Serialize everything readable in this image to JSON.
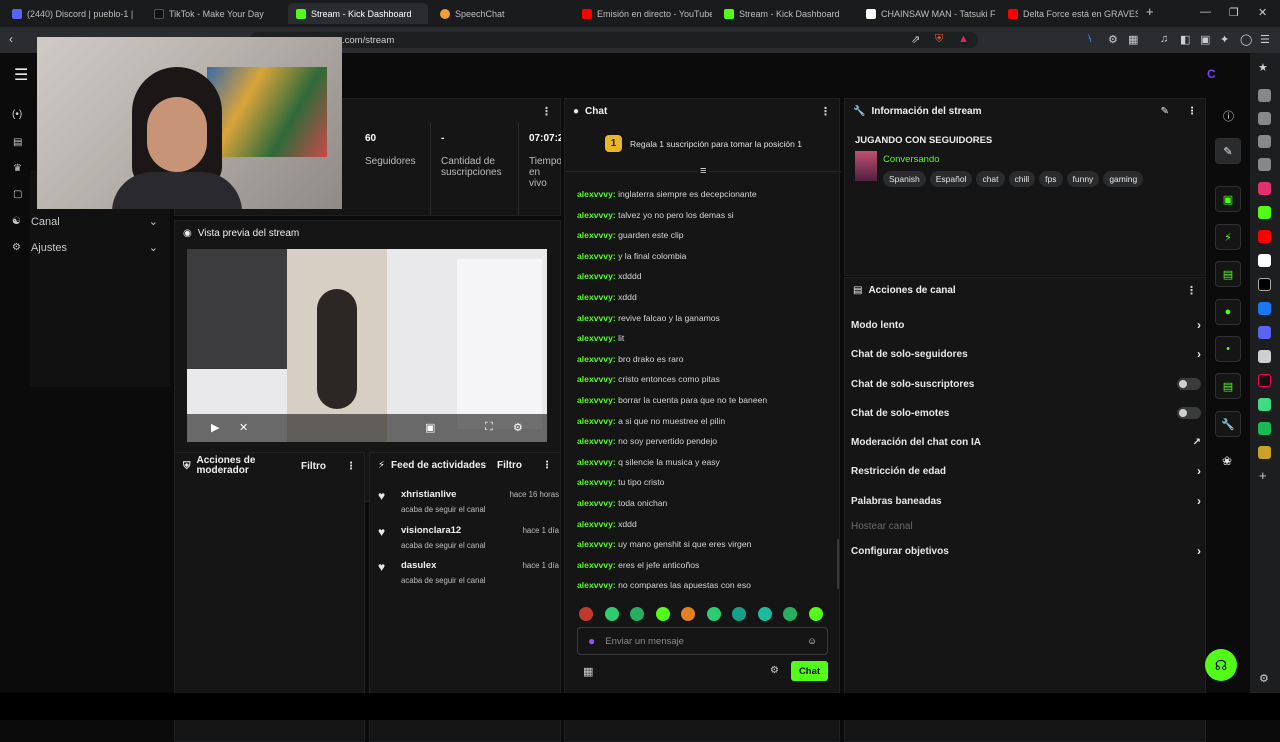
{
  "browser": {
    "tabs": [
      {
        "title": "(2440) Discord | pueblo-1 |",
        "color": "#5865f2"
      },
      {
        "title": "TikTok - Make Your Day",
        "color": "#111111"
      },
      {
        "title": "Stream - Kick Dashboard",
        "color": "#53fc18"
      },
      {
        "title": "SpeechChat",
        "color": "#f0a030"
      },
      {
        "title": "Emisión en directo - YouTube S",
        "color": "#ff0000"
      },
      {
        "title": "Stream - Kick Dashboard",
        "color": "#53fc18"
      },
      {
        "title": "CHAINSAW MAN - Tatsuki Fuj",
        "color": "#ffffff"
      },
      {
        "title": "Delta Force está en GRAVES PR",
        "color": "#ff0000"
      }
    ],
    "new_tab": "+",
    "url": ".com/stream"
  },
  "dashboard": {
    "stats": [
      {
        "value": "60",
        "label": "Seguidores"
      },
      {
        "value": "-",
        "label": "Cantidad de suscripciones"
      },
      {
        "value": "07:07:2",
        "label": "Tiempo en vivo"
      }
    ],
    "sidebar": [
      {
        "label": "Canal",
        "icon": "people-icon"
      },
      {
        "label": "Ajustes",
        "icon": "gear-icon"
      }
    ],
    "preview_title": "Vista previa del stream"
  },
  "mod_actions": {
    "title": "Acciones de moderador",
    "filter": "Filtro"
  },
  "activity": {
    "title": "Feed de actividades",
    "filter": "Filtro",
    "items": [
      {
        "name": "xhristianlive",
        "sub": "acaba de seguir el canal",
        "time": "hace 16 horas"
      },
      {
        "name": "visionclara12",
        "sub": "acaba de seguir el canal",
        "time": "hace 1 día"
      },
      {
        "name": "dasulex",
        "sub": "acaba de seguir el canal",
        "time": "hace 1 día"
      }
    ]
  },
  "chat": {
    "title": "Chat",
    "gift_banner": "Regala 1 suscripción para tomar la posición 1",
    "gift_rank": "1",
    "messages": [
      {
        "user": "alexvvvy:",
        "text": "inglaterra siempre es decepcionante"
      },
      {
        "user": "alexvvvy:",
        "text": "talvez yo no pero los demas si"
      },
      {
        "user": "alexvvvy:",
        "text": "guarden este clip"
      },
      {
        "user": "alexvvvy:",
        "text": "y la final colombia"
      },
      {
        "user": "alexvvvy:",
        "text": "xdddd"
      },
      {
        "user": "alexvvvy:",
        "text": "xddd"
      },
      {
        "user": "alexvvvy:",
        "text": "revive falcao y la ganamos"
      },
      {
        "user": "alexvvvy:",
        "text": "lit"
      },
      {
        "user": "alexvvvy:",
        "text": "bro drako es raro"
      },
      {
        "user": "alexvvvy:",
        "text": "cristo entonces como pitas"
      },
      {
        "user": "alexvvvy:",
        "text": "borrar la cuenta para que no te baneen"
      },
      {
        "user": "alexvvvy:",
        "text": "a si que no muestree el pilin"
      },
      {
        "user": "alexvvvy:",
        "text": "no soy pervertido pendejo"
      },
      {
        "user": "alexvvvy:",
        "text": "q silencie la musica y easy"
      },
      {
        "user": "alexvvvy:",
        "text": "tu tipo cristo"
      },
      {
        "user": "alexvvvy:",
        "text": "toda onichan"
      },
      {
        "user": "alexvvvy:",
        "text": "xddd"
      },
      {
        "user": "alexvvvy:",
        "text": "uy mano genshit si que eres virgen"
      },
      {
        "user": "alexvvvy:",
        "text": "eres el jefe anticoños"
      },
      {
        "user": "alexvvvy:",
        "text": "no compares las apuestas con eso"
      }
    ],
    "input_placeholder": "Enviar un mensaje",
    "send_label": "Chat"
  },
  "stream_info": {
    "title": "Información del stream",
    "stream_title": "JUGANDO CON SEGUIDORES",
    "category": "Conversando",
    "tags": [
      "Spanish",
      "Español",
      "chat",
      "chill",
      "fps",
      "funny",
      "gaming"
    ]
  },
  "channel_actions": {
    "title": "Acciones de canal",
    "rows": [
      {
        "label": "Modo lento",
        "kind": "chevron"
      },
      {
        "label": "Chat de solo-seguidores",
        "kind": "chevron"
      },
      {
        "label": "Chat de solo-suscriptores",
        "kind": "toggle"
      },
      {
        "label": "Chat de solo-emotes",
        "kind": "toggle"
      },
      {
        "label": "Moderación del chat con IA",
        "kind": "external"
      },
      {
        "label": "Restricción de edad",
        "kind": "chevron"
      },
      {
        "label": "Palabras baneadas",
        "kind": "chevron"
      },
      {
        "label": "Hostear canal",
        "kind": "disabled"
      },
      {
        "label": "Configurar objetivos",
        "kind": "chevron"
      }
    ]
  },
  "colors": {
    "accent": "#53fc18",
    "panel": "#151516",
    "background": "#0b0b0c"
  }
}
